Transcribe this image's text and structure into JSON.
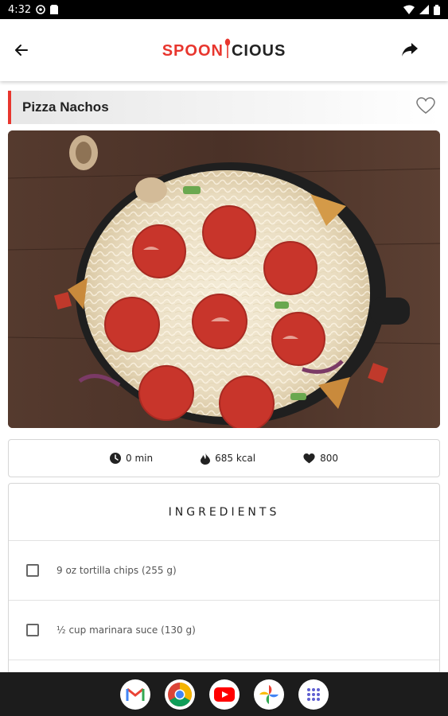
{
  "status_bar": {
    "time": "4:32",
    "icons": [
      "settings-circle-icon",
      "sim-card-icon"
    ],
    "right_icons": [
      "wifi-icon",
      "signal-icon",
      "battery-icon"
    ]
  },
  "app_bar": {
    "logo_left": "SPOON",
    "logo_right": "CIOUS",
    "back_icon": "arrow-left-icon",
    "share_icon": "share-arrow-icon"
  },
  "recipe": {
    "title": "Pizza Nachos",
    "favorite_icon": "heart-outline-icon",
    "stats": {
      "time": "0 min",
      "calories": "685 kcal",
      "likes": "800"
    }
  },
  "ingredients": {
    "heading": "INGREDIENTS",
    "items": [
      "9 oz tortilla chips (255 g)",
      "½ cup marinara suce (130 g)"
    ]
  },
  "nav_bar": {
    "apps": [
      "gmail-icon",
      "chrome-icon",
      "youtube-icon",
      "photos-icon",
      "app-drawer-icon"
    ]
  },
  "colors": {
    "accent": "#e8362e",
    "status_bar": "#000000",
    "nav_bar": "#1c1c1c"
  }
}
